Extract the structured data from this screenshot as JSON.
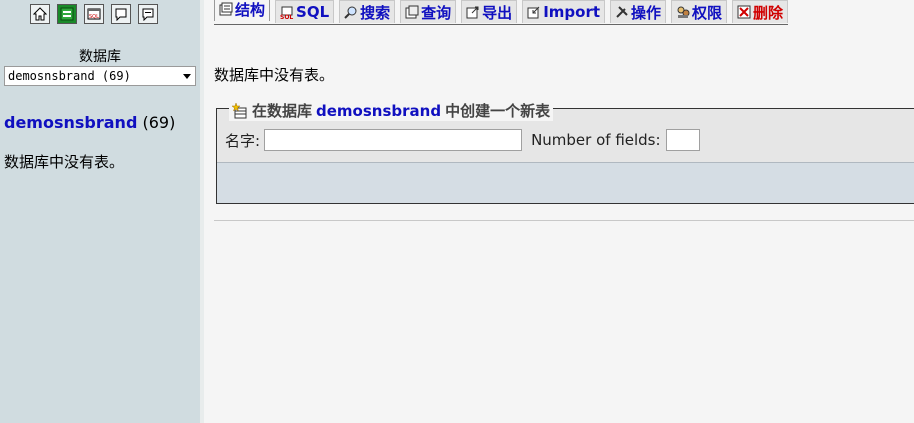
{
  "navigation": {
    "icons": [
      "home-icon",
      "query-window-icon",
      "sql-icon",
      "docs-icon",
      "help-icon"
    ],
    "database_label": "数据库",
    "database_select": "demosnsbrand (69)",
    "current_db": {
      "name": "demosnsbrand",
      "count": "(69)"
    },
    "empty_message": "数据库中没有表。"
  },
  "tabs": [
    {
      "label": "结构",
      "icon": "structure-icon",
      "active": true
    },
    {
      "label": "SQL",
      "icon": "sql-icon"
    },
    {
      "label": "搜索",
      "icon": "search-icon"
    },
    {
      "label": "查询",
      "icon": "query-icon"
    },
    {
      "label": "导出",
      "icon": "export-icon"
    },
    {
      "label": "Import",
      "icon": "import-icon"
    },
    {
      "label": "操作",
      "icon": "operations-icon"
    },
    {
      "label": "权限",
      "icon": "privileges-icon"
    },
    {
      "label": "删除",
      "icon": "drop-icon"
    }
  ],
  "main": {
    "empty_message": "数据库中没有表。",
    "create_table": {
      "legend_prefix": "在数据库",
      "legend_db": "demosnsbrand",
      "legend_suffix": "中创建一个新表",
      "name_label": "名字:",
      "name_value": "",
      "fields_label": "Number of fields:",
      "fields_value": ""
    }
  },
  "colors": {
    "nav_background": "#d0dce0",
    "link": "#1010c0",
    "drop_tab": "#d00000",
    "content_background": "#f5f5f5"
  }
}
